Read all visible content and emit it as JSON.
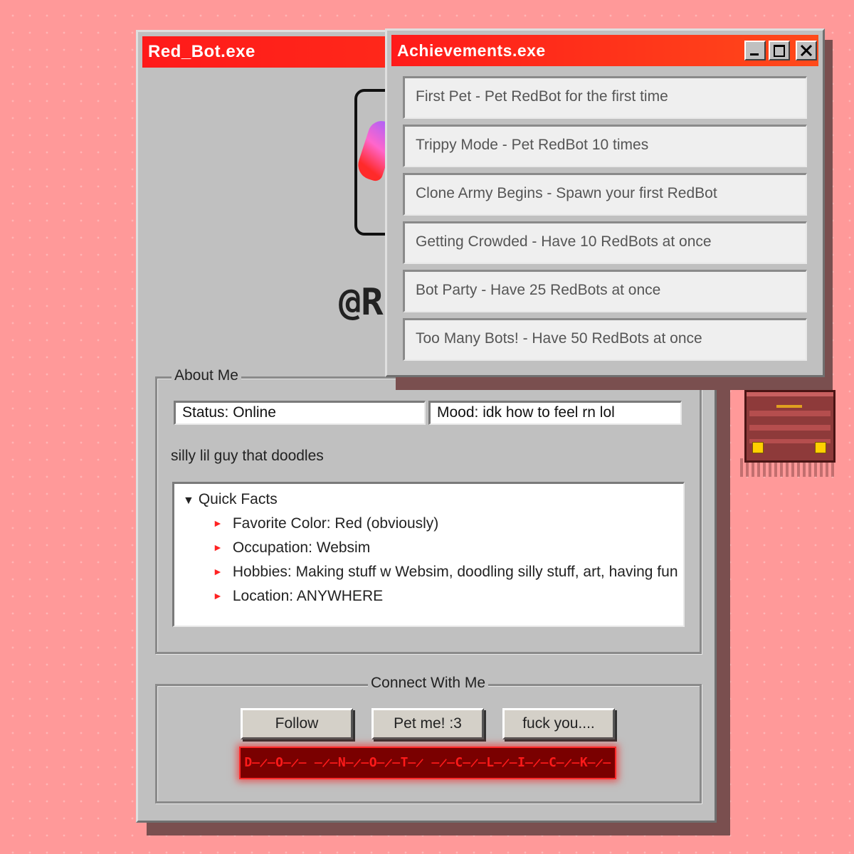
{
  "main_window": {
    "title": "Red_Bot.exe",
    "handle": "@R",
    "about": {
      "legend": "About Me",
      "status": "Status: Online",
      "mood": "Mood: idk how to feel rn lol",
      "bio": "silly lil guy that doodles",
      "quick_facts": {
        "title": "Quick Facts",
        "items": [
          "Favorite Color: Red (obviously)",
          "Occupation: Websim",
          "Hobbies: Making stuff w Websim, doodling silly stuff, art, having fun",
          "Location: ANYWHERE"
        ]
      }
    },
    "connect": {
      "legend": "Connect With Me",
      "buttons": [
        "Follow",
        "Pet me! :3",
        "fuck you...."
      ],
      "glitch_button": "D̶̷̶O̶̷̶ ̶̷̶N̶̷̶O̶̷̶T̶̷ ̶̷̶C̶̷̶L̶̷̶I̶̷̶C̶̷̶K̶̷̶"
    }
  },
  "achievements_window": {
    "title": "Achievements.exe",
    "controls": [
      "minimize",
      "maximize",
      "close"
    ],
    "items": [
      "First Pet - Pet RedBot for the first time",
      "Trippy Mode - Pet RedBot 10 times",
      "Clone Army Begins - Spawn your first RedBot",
      "Getting Crowded - Have 10 RedBots at once",
      "Bot Party - Have 25 RedBots at once",
      "Too Many Bots! - Have 50 RedBots at once"
    ]
  },
  "colors": {
    "desktop": "#ff9999",
    "titlebar": "#ff1a1a",
    "window": "#c0c0c0",
    "accent": "#ff2222"
  },
  "icons": {
    "chest": "treasure-chest-icon",
    "fact_bullet": "triangle-right-icon",
    "collapse": "triangle-down-icon"
  }
}
